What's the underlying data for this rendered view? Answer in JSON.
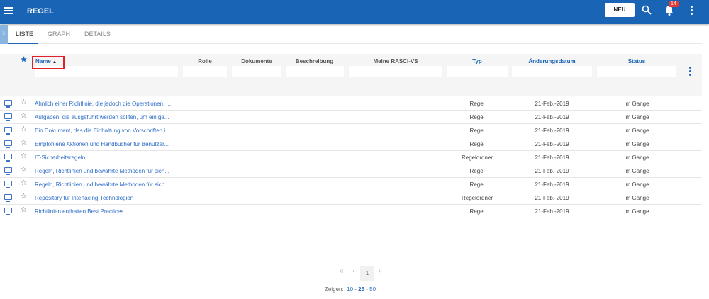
{
  "header": {
    "title": "REGEL",
    "new_label": "NEU",
    "notification_count": "14"
  },
  "tabs": [
    {
      "label": "LISTE"
    },
    {
      "label": "GRAPH"
    },
    {
      "label": "DETAILS"
    }
  ],
  "columns": {
    "name": "Name",
    "rolle": "Rolle",
    "dokumente": "Dokumente",
    "beschreibung": "Beschreibung",
    "rasci": "Meine RASCI-VS",
    "typ": "Typ",
    "datum": "Änderungsdatum",
    "status": "Status"
  },
  "sort_indicator": "▲",
  "rows": [
    {
      "name": "Ähnlich einer Richtlinie, die jedoch die Operationen, ...",
      "typ": "Regel",
      "datum": "21-Feb.-2019",
      "status": "Im Gange"
    },
    {
      "name": "Aufgaben, die ausgeführt werden sollten, um ein ge...",
      "typ": "Regel",
      "datum": "21-Feb.-2019",
      "status": "Im Gange"
    },
    {
      "name": "Ein Dokument, das die Einhaltung von Vorschriften i...",
      "typ": "Regel",
      "datum": "21-Feb.-2019",
      "status": "Im Gange"
    },
    {
      "name": "Empfohlene Aktionen und Handbücher für Benutzer...",
      "typ": "Regel",
      "datum": "21-Feb.-2019",
      "status": "Im Gange"
    },
    {
      "name": "IT-Sicherheitsregeln",
      "typ": "Regelordner",
      "datum": "21-Feb.-2019",
      "status": "Im Gange"
    },
    {
      "name": "Regeln, Richtlinien und bewährte Methoden für sich...",
      "typ": "Regel",
      "datum": "21-Feb.-2019",
      "status": "Im Gange"
    },
    {
      "name": "Regeln, Richtlinien und bewährte Methoden für sich...",
      "typ": "Regel",
      "datum": "21-Feb.-2019",
      "status": "Im Gange"
    },
    {
      "name": "Repository für Interfacing-Technologien",
      "typ": "Regelordner",
      "datum": "21-Feb.-2019",
      "status": "Im Gange"
    },
    {
      "name": "Richtlinien enthalten Best Practices.",
      "typ": "Regel",
      "datum": "21-Feb.-2019",
      "status": "Im Gange"
    }
  ],
  "pagination": {
    "current_page": "1",
    "show_label": "Zeigen:",
    "sizes": [
      "10",
      "25",
      "50"
    ],
    "selected_size": "25"
  }
}
